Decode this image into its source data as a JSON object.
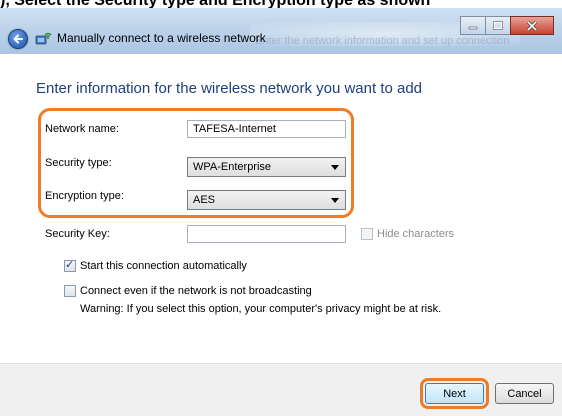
{
  "top_crop_text": "), Select the Security type and Encryption type as shown",
  "window": {
    "title": "Manually connect to a wireless network",
    "ghost_text": "Enter the network information and set up connection"
  },
  "form": {
    "heading": "Enter information for the wireless network you want to add",
    "network_name_label": "Network name:",
    "network_name_value": "TAFESA-Internet",
    "security_type_label": "Security type:",
    "security_type_value": "WPA-Enterprise",
    "encryption_type_label": "Encryption type:",
    "encryption_type_value": "AES",
    "security_key_label": "Security Key:",
    "security_key_value": "",
    "hide_characters_label": "Hide characters",
    "start_auto_label": "Start this connection automatically",
    "start_auto_checked": true,
    "connect_broadcast_label": "Connect even if the network is not broadcasting",
    "connect_broadcast_checked": false,
    "warning_text": "Warning: If you select this option, your computer's privacy might be at risk."
  },
  "buttons": {
    "next_label": "Next",
    "cancel_label": "Cancel"
  },
  "colors": {
    "highlight": "#f07b22",
    "heading": "#1e3f7b"
  }
}
